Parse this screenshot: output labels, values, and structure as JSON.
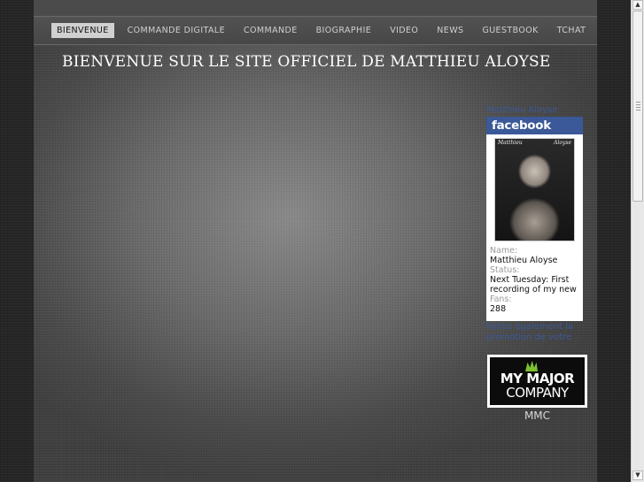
{
  "nav": {
    "items": [
      {
        "label": "BIENVENUE",
        "active": true
      },
      {
        "label": "COMMANDE DIGITALE",
        "active": false
      },
      {
        "label": "COMMANDE",
        "active": false
      },
      {
        "label": "BIOGRAPHIE",
        "active": false
      },
      {
        "label": "VIDEO",
        "active": false
      },
      {
        "label": "NEWS",
        "active": false
      },
      {
        "label": "GUESTBOOK",
        "active": false
      },
      {
        "label": "TCHAT",
        "active": false
      }
    ]
  },
  "main": {
    "title": "BIENVENUE SUR LE SITE OFFICIEL DE MATTHIEU ALOYSE"
  },
  "sidebar": {
    "facebook": {
      "header_link": "Matthieu Aloyse",
      "logo": "facebook",
      "photo_caption_left": "Matthieu",
      "photo_caption_right": "Aloyse",
      "name_label": "Name:",
      "name_value": "Matthieu Aloyse",
      "status_label": "Status:",
      "status_value": "Next Tuesday: First recording of my new single...",
      "fans_label": "Fans:",
      "fans_value": "288"
    },
    "promo_text": "Faites également la promotion de votre",
    "mmc": {
      "logo_line1": "MY MAJOR",
      "logo_line2": "COMPANY",
      "caption": "MMC"
    }
  },
  "scrollbar": {
    "up_icon": "arrow-up-icon",
    "down_icon": "arrow-down-icon"
  },
  "colors": {
    "facebook_blue": "#3b5998",
    "mmc_green": "#7cc030",
    "title_text": "#ffffff"
  }
}
